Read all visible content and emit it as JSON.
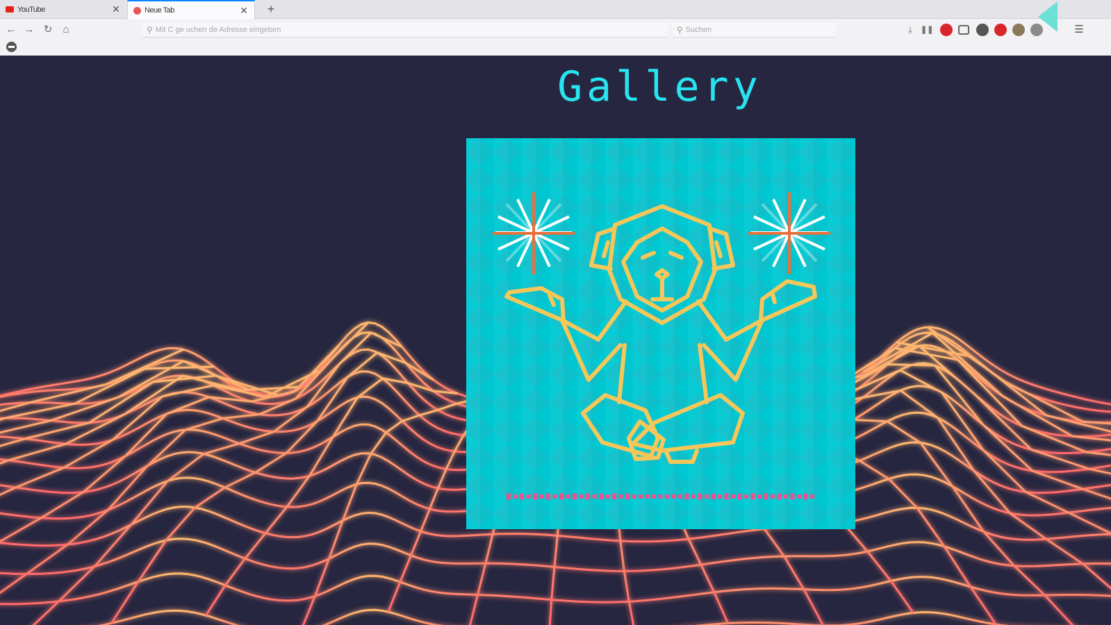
{
  "browser": {
    "tabs": [
      {
        "title": "YouTube",
        "active": false,
        "favicon_color": "#e62117"
      },
      {
        "title": "Neue Tab",
        "active": true,
        "favicon_color": "#e8545a"
      }
    ],
    "new_tab_symbol": "+",
    "close_symbol": "✕",
    "urlbar_placeholder": "Mit C ge uchen de Adresse eingeben",
    "searchbar_placeholder": "Suchen",
    "nav_icons": [
      "back-icon",
      "forward-icon",
      "reload-icon",
      "home-icon"
    ],
    "toolbar_icons": [
      {
        "name": "download-icon",
        "color": "#777"
      },
      {
        "name": "pause-icon",
        "color": "#777"
      },
      {
        "name": "extension-red-icon",
        "color": "#d9262b"
      },
      {
        "name": "reader-icon",
        "color": "#777"
      },
      {
        "name": "extension-dark-icon",
        "color": "#555"
      },
      {
        "name": "block-icon",
        "color": "#d9262b"
      },
      {
        "name": "extension-brown-icon",
        "color": "#8a7a5a"
      },
      {
        "name": "extension-gray-icon",
        "color": "#8a8a8a"
      },
      {
        "name": "menu-icon",
        "color": "#555"
      }
    ]
  },
  "page": {
    "title": "Gallery",
    "colors": {
      "background": "#262640",
      "title": "#28e4f0",
      "grid_top": "#ffb870",
      "grid_bottom": "#ff6a6a",
      "art_bg": "#00c8d2",
      "art_line": "#f5c75a",
      "art_accent": "#e8703a",
      "art_dots": "#f0508c"
    },
    "artwork": {
      "subject": "meditating-monkey-illustration"
    }
  }
}
